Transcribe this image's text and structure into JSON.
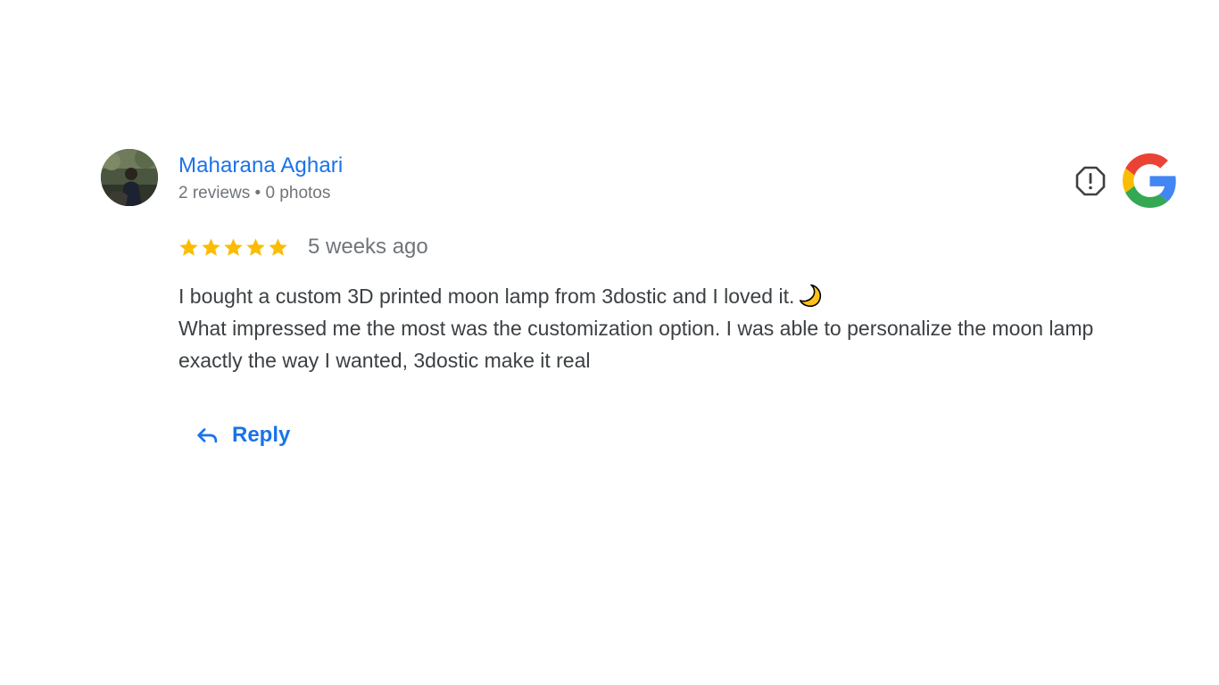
{
  "review": {
    "reviewer": {
      "name": "Maharana Aghari",
      "meta": "2 reviews • 0 photos",
      "avatar_icon": "user-photo"
    },
    "rating": {
      "stars": 5,
      "max_stars": 5,
      "time_ago": "5 weeks ago"
    },
    "text": {
      "line1": "I bought a custom 3D printed moon lamp from 3dostic and I loved it.",
      "emoji": "crescent-moon-emoji",
      "line2": "What impressed me the most was the customization option. I was able to personalize the moon lamp exactly the way I wanted, 3dostic make it real"
    },
    "actions": {
      "reply_label": "Reply",
      "reply_icon": "reply-arrow-icon",
      "flag_icon": "report-flag-icon"
    },
    "source_logo": "google-logo"
  },
  "colors": {
    "link_blue": "#1a73e8",
    "meta_gray": "#70757a",
    "text_dark": "#3c4043",
    "star_gold": "#fbbc04"
  }
}
